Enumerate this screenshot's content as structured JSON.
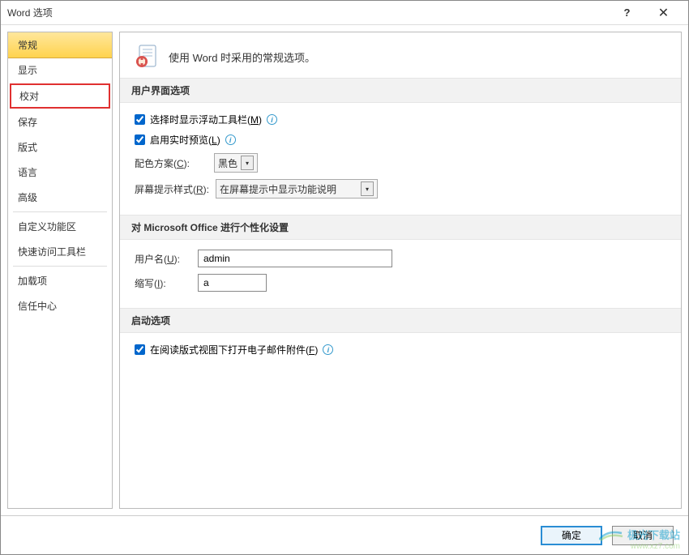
{
  "titlebar": {
    "title": "Word 选项",
    "help": "?",
    "close": "✕"
  },
  "sidebar": {
    "items": [
      {
        "label": "常规"
      },
      {
        "label": "显示"
      },
      {
        "label": "校对"
      },
      {
        "label": "保存"
      },
      {
        "label": "版式"
      },
      {
        "label": "语言"
      },
      {
        "label": "高级"
      },
      {
        "label": "自定义功能区"
      },
      {
        "label": "快速访问工具栏"
      },
      {
        "label": "加载项"
      },
      {
        "label": "信任中心"
      }
    ]
  },
  "header": {
    "text": "使用 Word 时采用的常规选项。"
  },
  "sections": {
    "ui": {
      "title": "用户界面选项",
      "floating_toolbar": "选择时显示浮动工具栏(M)",
      "live_preview": "启用实时预览(L)",
      "color_scheme_label": "配色方案(C):",
      "color_scheme_value": "黑色",
      "tooltip_style_label": "屏幕提示样式(R):",
      "tooltip_style_value": "在屏幕提示中显示功能说明"
    },
    "personal": {
      "title": "对 Microsoft Office 进行个性化设置",
      "username_label": "用户名(U):",
      "username_value": "admin",
      "initials_label": "缩写(I):",
      "initials_value": "a"
    },
    "startup": {
      "title": "启动选项",
      "reading_view": "在阅读版式视图下打开电子邮件附件(F)"
    }
  },
  "buttons": {
    "ok": "确定",
    "cancel": "取消"
  },
  "watermark": {
    "text1": "极光下载站",
    "text2": "www.xz7.com"
  }
}
